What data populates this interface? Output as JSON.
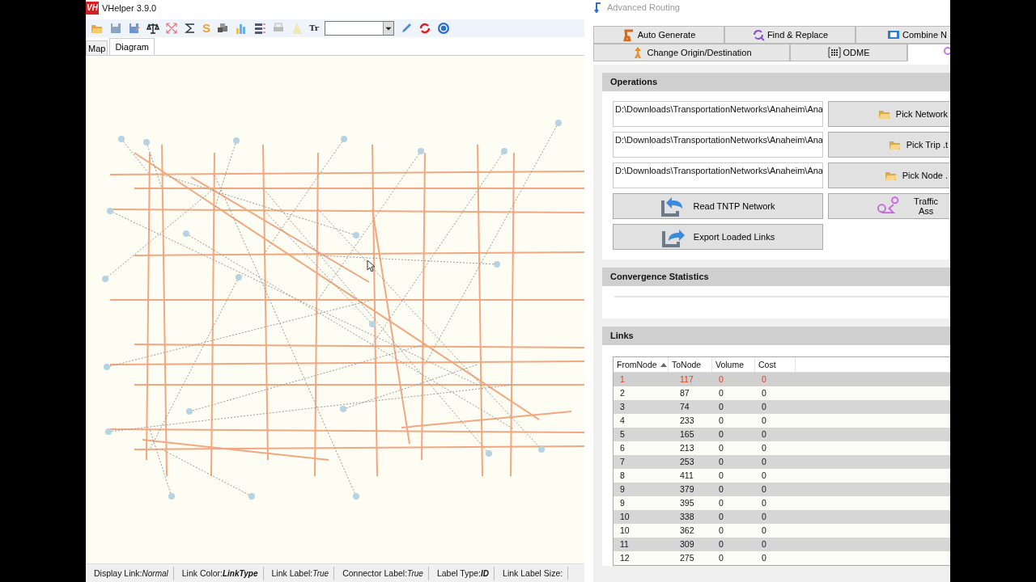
{
  "window": {
    "title": "VHelper 3.9.0",
    "logo": "VH"
  },
  "toolbar": {
    "glyphs": [
      "S",
      "Tr"
    ]
  },
  "view_tabs": [
    {
      "label": "Map",
      "selected": false
    },
    {
      "label": "Diagram",
      "selected": true
    }
  ],
  "status_bar": [
    {
      "label": "Display Link:",
      "value": "Normal",
      "emphasis": false
    },
    {
      "label": "Link Color:",
      "value": "LinkType",
      "emphasis": true
    },
    {
      "label": "Link Label:",
      "value": "True",
      "emphasis": false
    },
    {
      "label": "Connector Label:",
      "value": "True",
      "emphasis": false
    },
    {
      "label": "Label Type:",
      "value": "ID",
      "emphasis": true
    },
    {
      "label": "Link Label Size:"
    }
  ],
  "panel": {
    "title": "Advanced Routing",
    "tab_rows": [
      [
        {
          "label": "Auto Generate",
          "selected": false
        },
        {
          "label": "Find & Replace",
          "selected": false
        },
        {
          "label": "Combine N",
          "selected": false
        }
      ],
      [
        {
          "label": "Change Origin/Destination",
          "selected": false
        },
        {
          "label": "ODME",
          "selected": false
        },
        {
          "selected": true
        }
      ]
    ],
    "operations": {
      "title": "Operations",
      "files": [
        {
          "value": "D:\\Downloads\\TransportationNetworks\\Anaheim\\Ana",
          "button": "Pick Network"
        },
        {
          "value": "D:\\Downloads\\TransportationNetworks\\Anaheim\\Ana",
          "button": "Pick Trip .t"
        },
        {
          "value": "D:\\Downloads\\TransportationNetworks\\Anaheim\\Ana",
          "button": "Pick Node ."
        }
      ],
      "actions": [
        {
          "label": "Read TNTP Network"
        },
        {
          "label": "Traffic Ass"
        },
        {
          "label": "Export Loaded Links"
        }
      ]
    },
    "convergence": {
      "title": "Convergence Statistics"
    },
    "links": {
      "title": "Links",
      "columns": [
        {
          "label": "FromNode",
          "sorted": true
        },
        {
          "label": "ToNode",
          "sorted": false
        },
        {
          "label": "Volume",
          "sorted": false
        },
        {
          "label": "Cost",
          "sorted": false
        }
      ],
      "rows": [
        {
          "cells": [
            "1",
            "117",
            "0",
            "0"
          ],
          "selected": true
        },
        {
          "cells": [
            "2",
            "87",
            "0",
            "0"
          ],
          "selected": false
        },
        {
          "cells": [
            "3",
            "74",
            "0",
            "0"
          ],
          "selected": false
        },
        {
          "cells": [
            "4",
            "233",
            "0",
            "0"
          ],
          "selected": false
        },
        {
          "cells": [
            "5",
            "165",
            "0",
            "0"
          ],
          "selected": false
        },
        {
          "cells": [
            "6",
            "213",
            "0",
            "0"
          ],
          "selected": false
        },
        {
          "cells": [
            "7",
            "253",
            "0",
            "0"
          ],
          "selected": false
        },
        {
          "cells": [
            "8",
            "411",
            "0",
            "0"
          ],
          "selected": false
        },
        {
          "cells": [
            "9",
            "379",
            "0",
            "0"
          ],
          "selected": false
        },
        {
          "cells": [
            "9",
            "395",
            "0",
            "0"
          ],
          "selected": false
        },
        {
          "cells": [
            "10",
            "338",
            "0",
            "0"
          ],
          "selected": false
        },
        {
          "cells": [
            "10",
            "362",
            "0",
            "0"
          ],
          "selected": false
        },
        {
          "cells": [
            "11",
            "309",
            "0",
            "0"
          ],
          "selected": false
        },
        {
          "cells": [
            "12",
            "275",
            "0",
            "0"
          ],
          "selected": false
        }
      ]
    }
  }
}
